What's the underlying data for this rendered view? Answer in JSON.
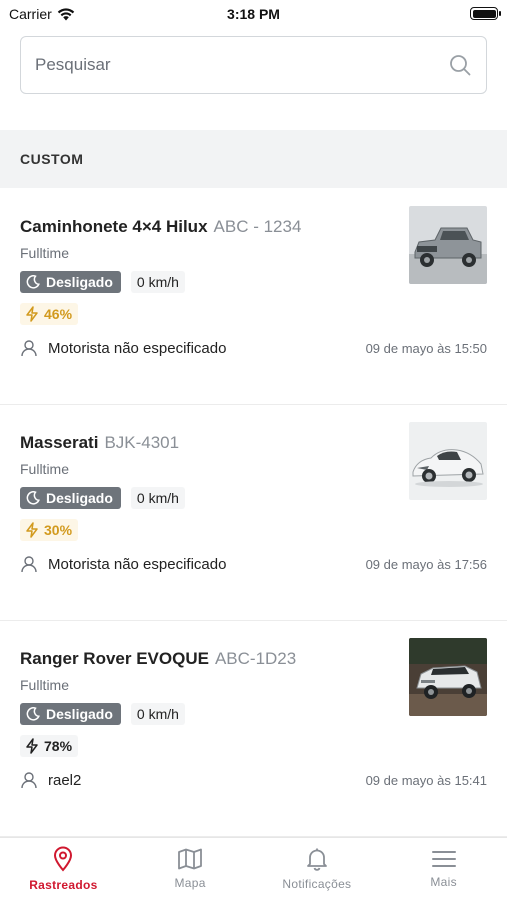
{
  "status_bar": {
    "carrier": "Carrier",
    "time": "3:18 PM"
  },
  "search": {
    "placeholder": "Pesquisar"
  },
  "section": {
    "title": "CUSTOM"
  },
  "vehicles": [
    {
      "name": "Caminhonete 4×4 Hilux",
      "plate": "ABC - 1234",
      "mode": "Fulltime",
      "status": "Desligado",
      "speed": "0 km/h",
      "battery": "46%",
      "driver": "Motorista não especificado",
      "timestamp": "09 de mayo às 15:50"
    },
    {
      "name": "Masserati",
      "plate": "BJK-4301",
      "mode": "Fulltime",
      "status": "Desligado",
      "speed": "0 km/h",
      "battery": "30%",
      "driver": "Motorista não especificado",
      "timestamp": "09 de mayo às 17:56"
    },
    {
      "name": "Ranger Rover EVOQUE",
      "plate": "ABC-1D23",
      "mode": "Fulltime",
      "status": "Desligado",
      "speed": "0 km/h",
      "battery": "78%",
      "driver": "rael2",
      "timestamp": "09 de mayo às 15:41"
    }
  ],
  "tabs": [
    {
      "label": "Rastreados",
      "icon": "map-pin-icon",
      "active": true
    },
    {
      "label": "Mapa",
      "icon": "map-icon",
      "active": false
    },
    {
      "label": "Notificações",
      "icon": "bell-icon",
      "active": false
    },
    {
      "label": "Mais",
      "icon": "menu-icon",
      "active": false
    }
  ],
  "colors": {
    "accent": "#d0182f",
    "status_badge": "#6e747b",
    "battery_warning": "#d29a1e"
  }
}
